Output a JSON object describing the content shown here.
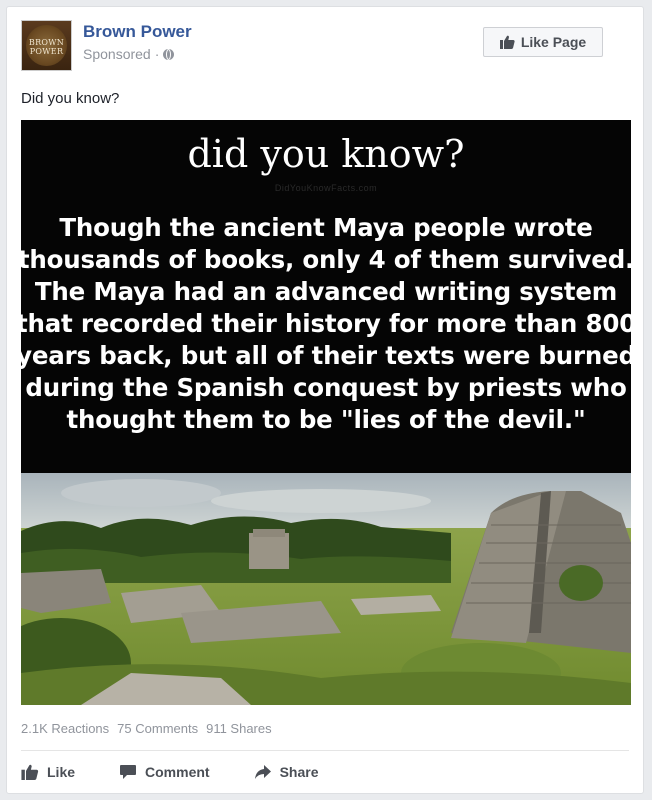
{
  "post": {
    "page_name": "Brown Power",
    "sponsored": "Sponsored",
    "sponsored_sep": "·",
    "like_page_label": "Like Page",
    "text": "Did you know?",
    "avatar_logo_line1": "BROWN",
    "avatar_logo_line2": "POWER"
  },
  "image": {
    "title": "did you know?",
    "watermark": "DidYouKnowFacts.com",
    "fact": "Though the ancient Maya people wrote thousands of books, only 4 of them survived. The Maya had an advanced writing system that recorded their history for more than 800 years back, but all of their texts were burned during the Spanish conquest by priests who thought them to be \"lies of the devil.\""
  },
  "stats": {
    "reactions": "2.1K Reactions",
    "comments": "75 Comments",
    "shares": "911 Shares"
  },
  "actions": {
    "like": "Like",
    "comment": "Comment",
    "share": "Share"
  },
  "colors": {
    "link_blue": "#365899",
    "meta_gray": "#90949c",
    "action_gray": "#4b4f56"
  },
  "icons": {
    "like_page": "thumbs-up-icon",
    "globe": "globe-icon",
    "like": "thumbs-up-icon",
    "comment": "speech-bubble-icon",
    "share": "share-arrow-icon"
  }
}
